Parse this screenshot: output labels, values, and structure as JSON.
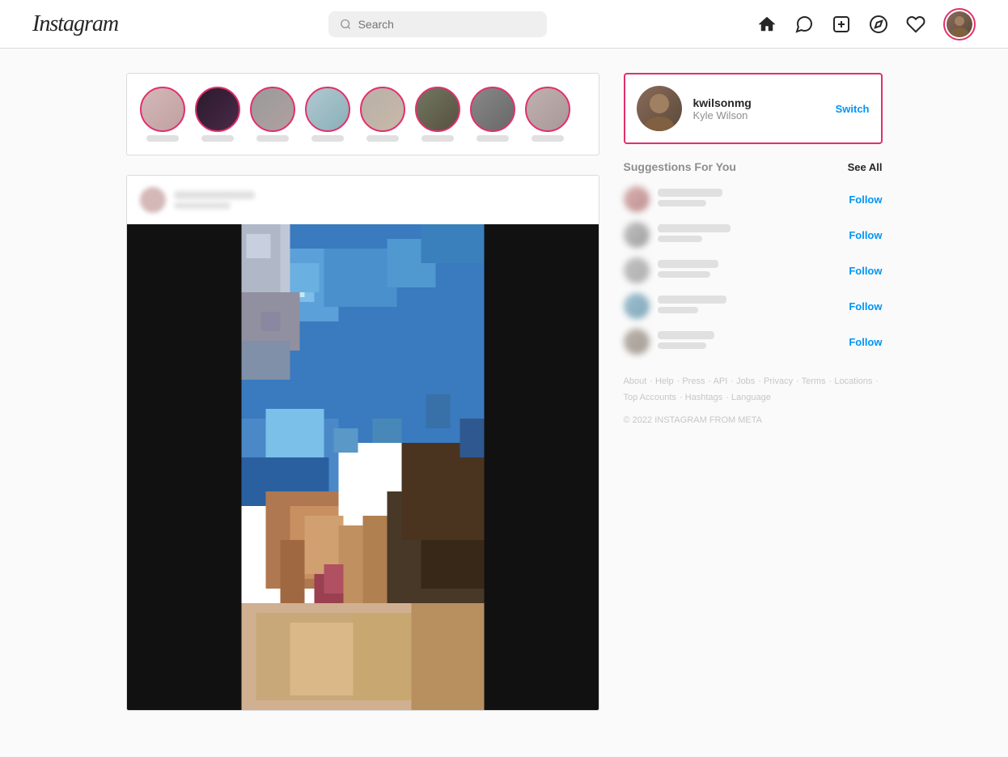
{
  "navbar": {
    "logo": "Instagram",
    "search_placeholder": "Search",
    "icons": [
      "home",
      "messenger",
      "add",
      "compass",
      "heart",
      "profile"
    ]
  },
  "profile": {
    "username": "kwilsonmg",
    "name": "Kyle Wilson",
    "switch_label": "Switch"
  },
  "suggestions": {
    "title": "Suggestions For You",
    "see_all": "See All",
    "items": [
      {
        "follow": "Follow"
      },
      {
        "follow": "Follow"
      },
      {
        "follow": "Follow"
      },
      {
        "follow": "Follow"
      },
      {
        "follow": "Follow"
      }
    ]
  },
  "footer": {
    "links": [
      "About",
      "Help",
      "Press",
      "API",
      "Jobs",
      "Privacy",
      "Terms",
      "Locations",
      "Top Accounts",
      "Hashtags",
      "Language"
    ],
    "copyright": "© 2022 INSTAGRAM FROM META"
  }
}
